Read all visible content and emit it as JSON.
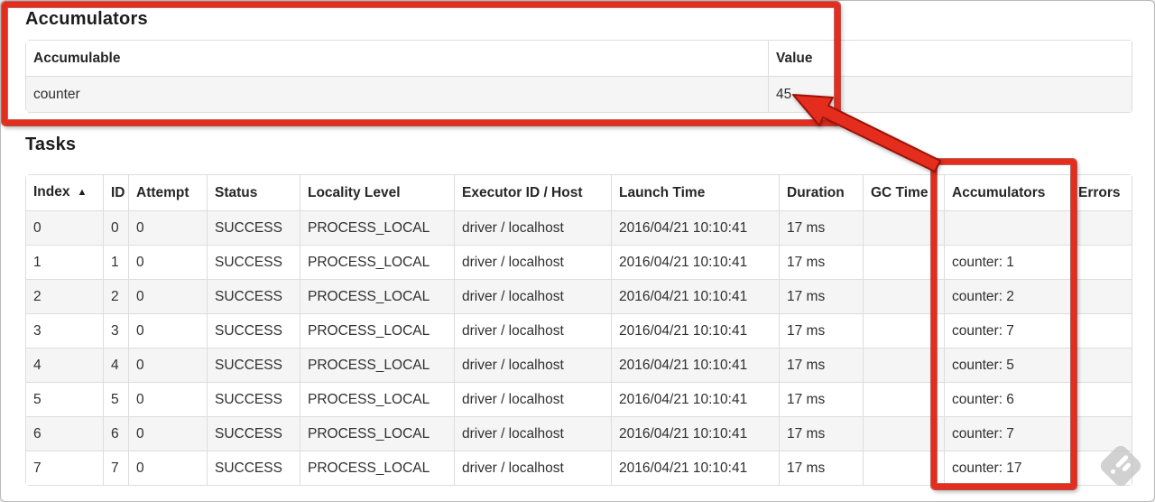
{
  "accumulators_section": {
    "title": "Accumulators",
    "table": {
      "columns": [
        {
          "key": "accumulable",
          "label": "Accumulable"
        },
        {
          "key": "value",
          "label": "Value"
        }
      ],
      "rows": [
        {
          "accumulable": "counter",
          "value": "45"
        }
      ]
    }
  },
  "tasks_section": {
    "title": "Tasks",
    "table": {
      "columns": [
        {
          "key": "index",
          "label": "Index",
          "sort_indicator": "▲"
        },
        {
          "key": "id",
          "label": "ID"
        },
        {
          "key": "attempt",
          "label": "Attempt"
        },
        {
          "key": "status",
          "label": "Status"
        },
        {
          "key": "locality_level",
          "label": "Locality Level"
        },
        {
          "key": "executor_id_host",
          "label": "Executor ID / Host"
        },
        {
          "key": "launch_time",
          "label": "Launch Time"
        },
        {
          "key": "duration",
          "label": "Duration"
        },
        {
          "key": "gc_time",
          "label": "GC Time"
        },
        {
          "key": "accumulators",
          "label": "Accumulators"
        },
        {
          "key": "errors",
          "label": "Errors"
        }
      ],
      "rows": [
        {
          "index": "0",
          "id": "0",
          "attempt": "0",
          "status": "SUCCESS",
          "locality_level": "PROCESS_LOCAL",
          "executor_id_host": "driver / localhost",
          "launch_time": "2016/04/21 10:10:41",
          "duration": "17 ms",
          "gc_time": "",
          "accumulators": "",
          "errors": ""
        },
        {
          "index": "1",
          "id": "1",
          "attempt": "0",
          "status": "SUCCESS",
          "locality_level": "PROCESS_LOCAL",
          "executor_id_host": "driver / localhost",
          "launch_time": "2016/04/21 10:10:41",
          "duration": "17 ms",
          "gc_time": "",
          "accumulators": "counter: 1",
          "errors": ""
        },
        {
          "index": "2",
          "id": "2",
          "attempt": "0",
          "status": "SUCCESS",
          "locality_level": "PROCESS_LOCAL",
          "executor_id_host": "driver / localhost",
          "launch_time": "2016/04/21 10:10:41",
          "duration": "17 ms",
          "gc_time": "",
          "accumulators": "counter: 2",
          "errors": ""
        },
        {
          "index": "3",
          "id": "3",
          "attempt": "0",
          "status": "SUCCESS",
          "locality_level": "PROCESS_LOCAL",
          "executor_id_host": "driver / localhost",
          "launch_time": "2016/04/21 10:10:41",
          "duration": "17 ms",
          "gc_time": "",
          "accumulators": "counter: 7",
          "errors": ""
        },
        {
          "index": "4",
          "id": "4",
          "attempt": "0",
          "status": "SUCCESS",
          "locality_level": "PROCESS_LOCAL",
          "executor_id_host": "driver / localhost",
          "launch_time": "2016/04/21 10:10:41",
          "duration": "17 ms",
          "gc_time": "",
          "accumulators": "counter: 5",
          "errors": ""
        },
        {
          "index": "5",
          "id": "5",
          "attempt": "0",
          "status": "SUCCESS",
          "locality_level": "PROCESS_LOCAL",
          "executor_id_host": "driver / localhost",
          "launch_time": "2016/04/21 10:10:41",
          "duration": "17 ms",
          "gc_time": "",
          "accumulators": "counter: 6",
          "errors": ""
        },
        {
          "index": "6",
          "id": "6",
          "attempt": "0",
          "status": "SUCCESS",
          "locality_level": "PROCESS_LOCAL",
          "executor_id_host": "driver / localhost",
          "launch_time": "2016/04/21 10:10:41",
          "duration": "17 ms",
          "gc_time": "",
          "accumulators": "counter: 7",
          "errors": ""
        },
        {
          "index": "7",
          "id": "7",
          "attempt": "0",
          "status": "SUCCESS",
          "locality_level": "PROCESS_LOCAL",
          "executor_id_host": "driver / localhost",
          "launch_time": "2016/04/21 10:10:41",
          "duration": "17 ms",
          "gc_time": "",
          "accumulators": "counter: 17",
          "errors": ""
        }
      ]
    }
  },
  "annotations": {
    "highlight_color": "#e52d1e"
  }
}
